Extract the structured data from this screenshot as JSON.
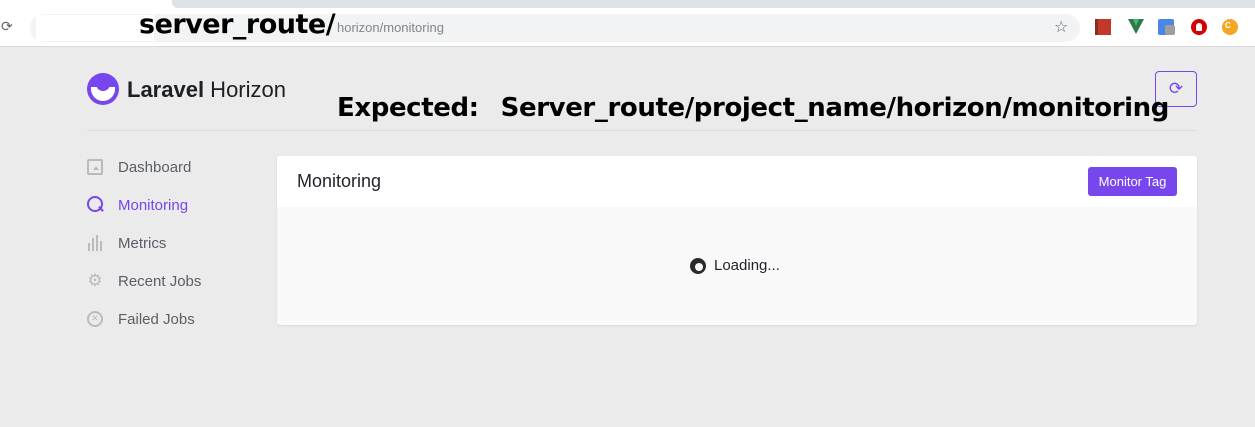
{
  "browser": {
    "reload_glyph": "⟳",
    "star_glyph": "☆",
    "url_path": "horizon/monitoring",
    "annotation_server": "server_route/",
    "extensions": [
      "red-bookmark-icon",
      "vue-devtools-icon",
      "google-translate-icon",
      "adblock-icon",
      "cookie-icon"
    ],
    "ext5_text": "C"
  },
  "header": {
    "brand_bold": "Laravel",
    "brand_rest": " Horizon",
    "refresh_glyph": "⟳",
    "annotation_expected_label": "Expected:",
    "annotation_expected_value": "Server_route/project_name/horizon/monitoring"
  },
  "sidebar": {
    "items": [
      {
        "label": "Dashboard",
        "icon": "dashboard-icon",
        "active": false
      },
      {
        "label": "Monitoring",
        "icon": "search-icon",
        "active": true
      },
      {
        "label": "Metrics",
        "icon": "metrics-icon",
        "active": false
      },
      {
        "label": "Recent Jobs",
        "icon": "gear-icon",
        "active": false
      },
      {
        "label": "Failed Jobs",
        "icon": "x-circle-icon",
        "active": false
      }
    ]
  },
  "main": {
    "title": "Monitoring",
    "monitor_tag_label": "Monitor Tag",
    "loading_text": "Loading..."
  },
  "colors": {
    "accent": "#7746ec",
    "background": "#ebebeb",
    "card": "#ffffff"
  }
}
